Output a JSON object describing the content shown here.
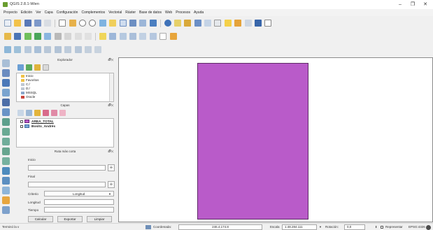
{
  "window": {
    "title": "QGIS 2.8.1-Wien",
    "controls": [
      "–",
      "❐",
      "✕"
    ]
  },
  "menu": [
    "Proyecto",
    "Edición",
    "Ver",
    "Capa",
    "Configuración",
    "Complementos",
    "Vectorial",
    "Ráster",
    "Base de datos",
    "Web",
    "Procesos",
    "Ayuda"
  ],
  "browser_panel": {
    "title": "Explorador",
    "items": [
      "Inicio",
      "Favoritos",
      "C:/",
      "D:/",
      "MSSQL",
      "Oracle"
    ]
  },
  "layers_panel": {
    "title": "Capas",
    "layers": [
      "AREA_TOTAL",
      "Bosito_Andrés"
    ]
  },
  "route_panel": {
    "title": "Ruta más corta",
    "start_label": "Inicio",
    "end_label": "Final",
    "criterion_label": "Criterio",
    "criterion_value": "Longitud",
    "length_label": "Longitud",
    "time_label": "Tiempo",
    "calculate_button": "Calcular",
    "export_button": "Exportar",
    "clear_button": "Limpiar"
  },
  "status_bar": {
    "left_text": "Terminó la v",
    "coordinate_label": "Coordenada:",
    "coordinate_value": "246.4,174.8",
    "scale_label": "Escala",
    "scale_value": "1:48.284.111",
    "rotation_label": "Rotación:",
    "rotation_value": "0,0",
    "render_label": "Representar",
    "crs_label": "EPSG:4326"
  },
  "colors": {
    "polygon_fill": "#b95bc9",
    "polygon_stroke": "#5e2a66"
  }
}
